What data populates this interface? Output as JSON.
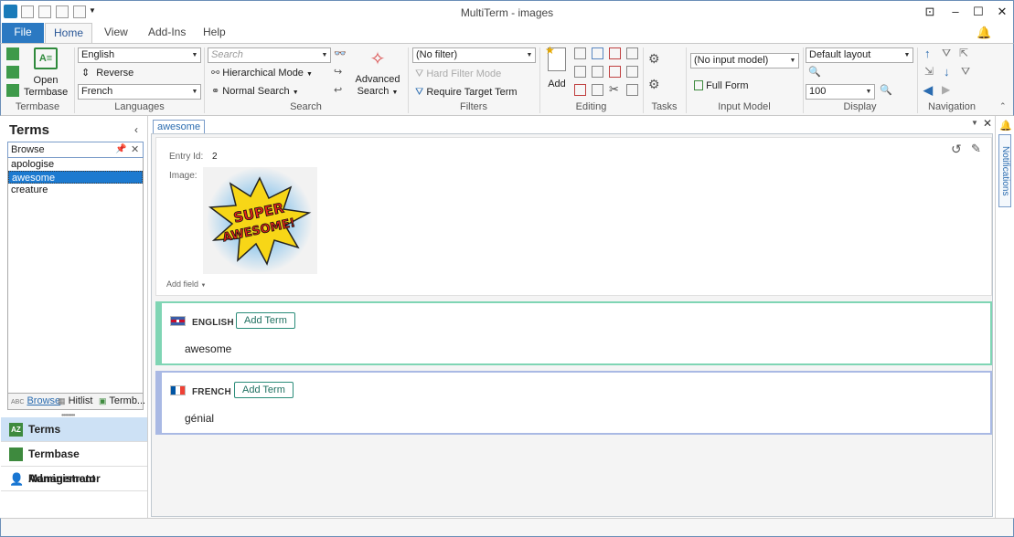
{
  "window": {
    "title": "MultiTerm - images",
    "controls": {
      "restore": "⊡",
      "minimize": "–",
      "maximize": "☐",
      "close": "✕"
    }
  },
  "tabs": {
    "file": "File",
    "home": "Home",
    "view": "View",
    "addins": "Add-Ins",
    "help": "Help"
  },
  "ribbon": {
    "termbase": {
      "open_label_1": "Open",
      "open_label_2": "Termbase",
      "group": "Termbase"
    },
    "languages": {
      "source": "English",
      "reverse": "Reverse",
      "target": "French",
      "group": "Languages"
    },
    "search": {
      "placeholder": "Search",
      "hierarchical": "Hierarchical Mode",
      "normal": "Normal Search",
      "advanced_1": "Advanced",
      "advanced_2": "Search",
      "group": "Search"
    },
    "filters": {
      "filter": "(No filter)",
      "hard_filter": "Hard Filter Mode",
      "require_target": "Require Target Term",
      "group": "Filters"
    },
    "editing": {
      "add": "Add",
      "group": "Editing"
    },
    "tasks": {
      "group": "Tasks"
    },
    "input_model": {
      "value": "(No input model)",
      "full_form": "Full Form",
      "group": "Input Model"
    },
    "display": {
      "layout": "Default layout",
      "zoom": "100",
      "group": "Display"
    },
    "navigation": {
      "group": "Navigation"
    }
  },
  "left_panel": {
    "title": "Terms",
    "browse_value": "Browse",
    "terms": [
      "apologise",
      "awesome",
      "creature"
    ],
    "selected_index": 1,
    "bottom_tabs": {
      "browse": "Browse",
      "hitlist": "Hitlist",
      "termbase": "Termb..."
    },
    "nav": {
      "terms": "Terms",
      "termbase_mgmt": "Termbase Management",
      "administrator": "Administrator"
    }
  },
  "document": {
    "tab": "awesome",
    "entry_id_label": "Entry Id:",
    "entry_id": "2",
    "image_label": "Image:",
    "image_text_1": "SUPER",
    "image_text_2": "AWESOME!",
    "add_field": "Add field",
    "languages": [
      {
        "name": "ENGLISH",
        "add_term": "Add Term",
        "term": "awesome"
      },
      {
        "name": "FRENCH",
        "add_term": "Add Term",
        "term": "génial"
      }
    ]
  },
  "notifications": {
    "label": "Notifications"
  },
  "colors": {
    "english_strip": "#7fd5b4",
    "french_strip": "#a9b9e4",
    "selection": "#1c7ad0",
    "file_tab": "#2b79c2"
  }
}
